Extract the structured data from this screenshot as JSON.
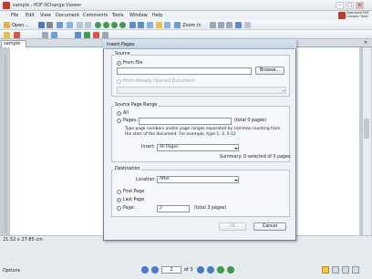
{
  "window": {
    "title": "sample - PDF-XChange Viewer",
    "minimize": "–",
    "maximize": "□",
    "close": "✕"
  },
  "menu": [
    "File",
    "Edit",
    "View",
    "Document",
    "Comments",
    "Tools",
    "Window",
    "Help"
  ],
  "promo": {
    "text": "Download PDF Creation Tools"
  },
  "toolbar": {
    "open_label": "Open...",
    "zoom_label": "Zoom In",
    "search_icon": "magnifier-icon"
  },
  "tab": {
    "label": "sample",
    "close": "✕"
  },
  "status": {
    "dimensions": "21.52 x 27.85 cm",
    "options": "Options",
    "current_page": "2",
    "page_of": "of 3"
  },
  "dialog": {
    "title": "Insert Pages",
    "source": {
      "title": "Source",
      "from_file": "From File",
      "browse": "Browse...",
      "from_open": "From Already Opened Document"
    },
    "range": {
      "title": "Source Page Range",
      "all": "All",
      "pages": "Pages:",
      "pages_count": "(total 0 pages)",
      "hint": "Type page numbers and/or page ranges separated by commas counting from the start of the document. For example, type 1, 3, 5-12",
      "insert_label": "Insert:",
      "insert_value": "All Pages",
      "summary": "Summary: 0 selected of 0 pages"
    },
    "destination": {
      "title": "Destination",
      "location_label": "Location:",
      "location_value": "After",
      "first_page": "First Page",
      "last_page": "Last Page",
      "page": "Page:",
      "page_value": "2",
      "page_total": "(total 3 pages)"
    },
    "ok": "OK",
    "cancel": "Cancel"
  }
}
